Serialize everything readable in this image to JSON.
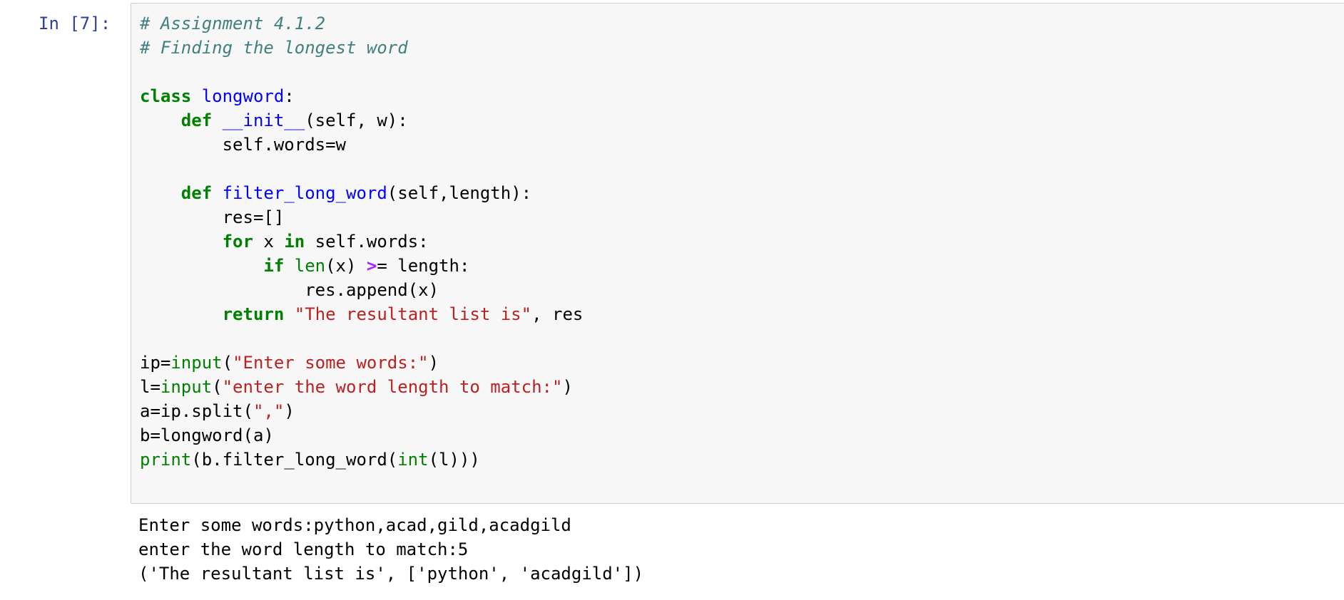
{
  "cell": {
    "prompt": "In [7]:",
    "code": {
      "comment1": "# Assignment 4.1.2",
      "comment2": "# Finding the longest word",
      "kw_class": "class",
      "class_name": "longword",
      "colon": ":",
      "indent4": "    ",
      "indent8": "        ",
      "indent12": "            ",
      "indent16": "                ",
      "kw_def": "def",
      "fn_init": "__init__",
      "init_args": "(self, w):",
      "assign_words": "self.words=w",
      "fn_filter": "filter_long_word",
      "filter_args": "(self,length):",
      "res_init": "res=[]",
      "kw_for": "for",
      "for_var": " x ",
      "kw_in": "in",
      "for_rest": " self.words:",
      "kw_if": "if",
      "fn_len": "len",
      "len_args": "(x) ",
      "op_ge_part": ">",
      "ge_rest": "= length:",
      "append_call": "res.append(x)",
      "kw_return": "return",
      "return_str": "\"The resultant list is\"",
      "return_rest": ", res",
      "ip_assign": "ip=",
      "fn_input": "input",
      "open_paren": "(",
      "close_paren": ")",
      "str_enter_words": "\"Enter some words:\"",
      "l_assign": "l=",
      "str_enter_length": "\"enter the word length to match:\"",
      "split_call": "a=ip.split(",
      "str_comma": "\",\"",
      "b_assign": "b=longword(a)",
      "fn_print": "print",
      "print_mid": "(b.filter_long_word(",
      "fn_int": "int",
      "print_end": "(l)))"
    },
    "output": [
      "Enter some words:python,acad,gild,acadgild",
      "enter the word length to match:5",
      "('The resultant list is', ['python', 'acadgild'])"
    ]
  }
}
